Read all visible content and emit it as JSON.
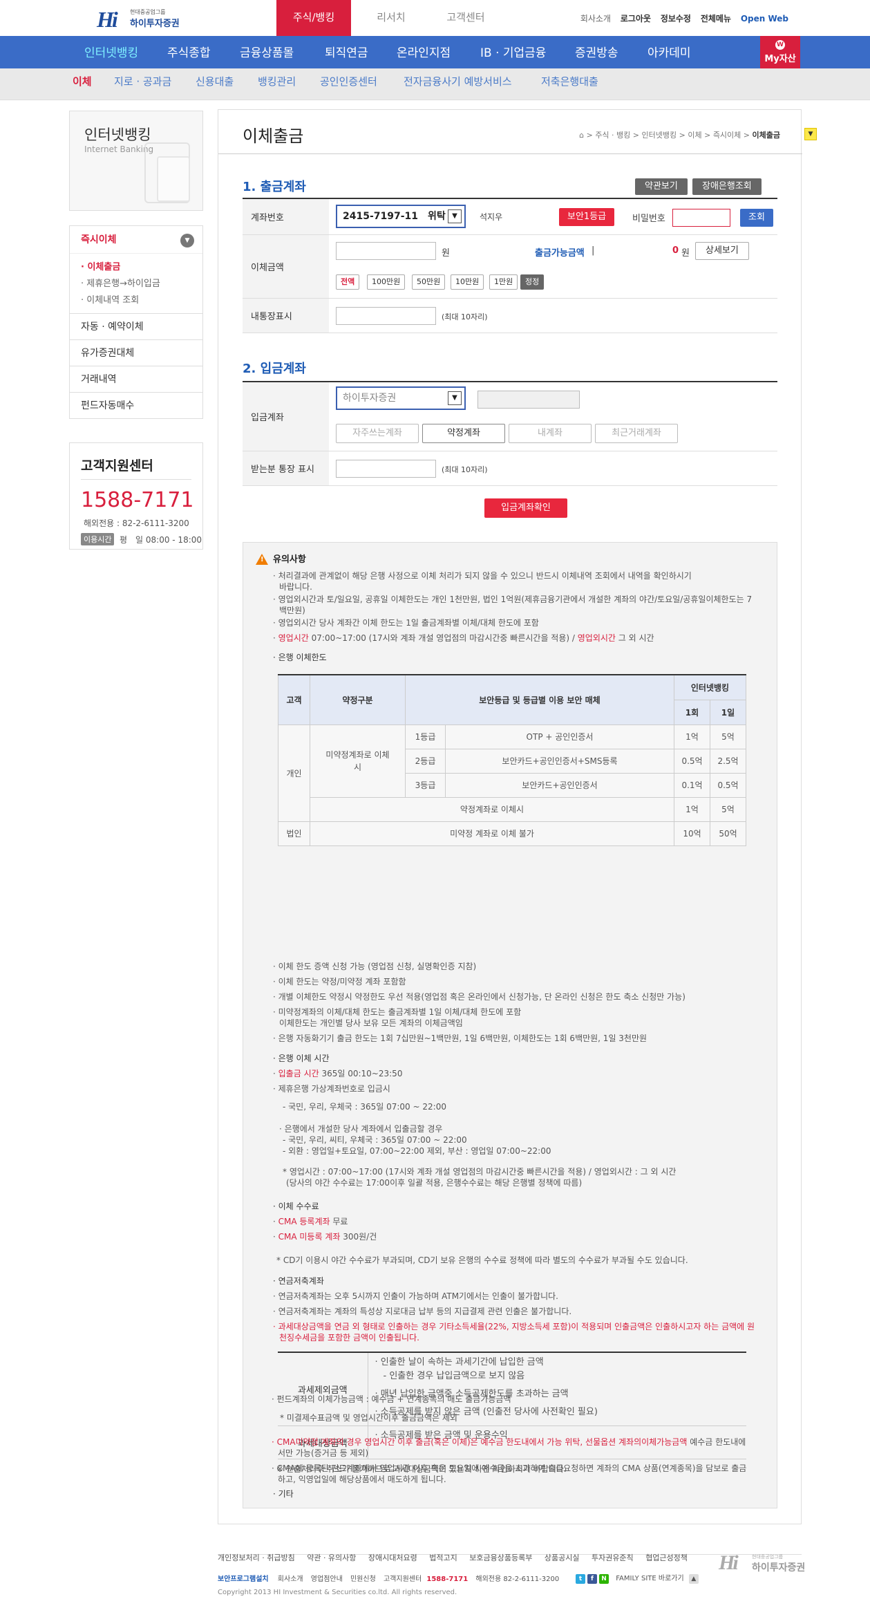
{
  "header": {
    "logo_sub": "현대중공업그룹",
    "logo_name": "하이투자증권",
    "tabs": [
      "주식/뱅킹",
      "리서치",
      "고객센터"
    ],
    "util": [
      "회사소개",
      "로그아웃",
      "정보수정",
      "전체메뉴",
      "Open Web"
    ]
  },
  "gnb": [
    "인터넷뱅킹",
    "주식종합",
    "금융상품몰",
    "퇴직연금",
    "온라인지점",
    "IB · 기업금융",
    "증권방송",
    "아카데미"
  ],
  "myasset": "My자산",
  "lnb": [
    "이체",
    "지로 · 공과금",
    "신용대출",
    "뱅킹관리",
    "공인인증센터",
    "전자금융사기 예방서비스",
    "저축은행대출"
  ],
  "left": {
    "title": "인터넷뱅킹",
    "title_en": "Internet Banking",
    "menu_head": "즉시이체",
    "sub": [
      "이체출금",
      "제휴은행→하이입금",
      "이체내역 조회"
    ],
    "rows": [
      "자동 · 예약이체",
      "유가증권대체",
      "거래내역",
      "펀드자동매수"
    ],
    "cs_title": "고객지원센터",
    "cs_phone": "1588-7171",
    "cs_overseas": "해외전용 : 82-2-6111-3200",
    "cs_hours_label": "이용시간",
    "cs_hours": "평　일 08:00 - 18:00"
  },
  "main": {
    "title": "이체출금",
    "breadcrumb": [
      "주식 · 뱅킹",
      "인터넷뱅킹",
      "이체",
      "즉시이체",
      "이체출금"
    ],
    "sec1": "1. 출금계좌",
    "btn_terms": "약관보기",
    "btn_failure": "장애은행조회",
    "lbl_account": "계좌번호",
    "account_value": "2415-7197-11　위탁",
    "account_name": "석지우",
    "security_badge": "보안1등급",
    "lbl_password": "비밀번호",
    "btn_inquiry": "조회",
    "lbl_amount": "이체금액",
    "won": "원",
    "avail_label": "출금가능금액",
    "avail_value": "0",
    "btn_detail": "상세보기",
    "amount_btns": [
      "전액",
      "100만원",
      "50만원",
      "10만원",
      "1만원",
      "정정"
    ],
    "lbl_memo": "내통장표시",
    "max10": "(최대 10자리)",
    "sec2": "2. 입금계좌",
    "lbl_in_account": "입금계좌",
    "bank_select": "하이투자증권",
    "acct_tabs": [
      "자주쓰는계좌",
      "약정계좌",
      "내계좌",
      "최근거래계좌"
    ],
    "lbl_recv": "받는분 통장 표시",
    "btn_confirm": "입금계좌확인"
  },
  "notice": {
    "title": "유의사항",
    "n1a": "· 처리결과에 관계없이 해당 은행 사정으로 이체 처리가 되지 않을 수 있으니 반드시 이체내역 조회에서 내역을 확인하시기",
    "n1b": "바랍니다.",
    "n2a": "· 영업외시간과 토/일요일, 공휴일 이체한도는 개인 1천만원, 법인 1억원(제휴금융기관에서 개설한 계좌의 야간/토요일/공휴일이체한도는 7",
    "n2b": "백만원)",
    "n3": "· 영업외시간 당사 계좌간 이체 한도는 1일 출금계좌별 이체/대체 한도에 포함",
    "n4_pre": "· ",
    "n4_r1": "영업시간",
    "n4_mid": " 07:00~17:00 (17시와 계좌 개설 영업점의 마감시간중 빠른시간을 적용) / ",
    "n4_r2": "영업외시간",
    "n4_post": " 그 외 시간",
    "limit_head": "· 은행 이체한도",
    "tbl": {
      "h_customer": "고객",
      "h_contract": "약정구분",
      "h_media": "보안등급 및 등급별 이용 보안 매체",
      "h_inet": "인터넷뱅킹",
      "h_once": "1회",
      "h_day": "1일",
      "personal": "개인",
      "noncontract": "미약정계좌로 이체시",
      "grades": [
        "1등급",
        "2등급",
        "3등급"
      ],
      "medias": [
        "OTP + 공인인증서",
        "보안카드+공인인증서+SMS등록",
        "보안카드+공인인증서"
      ],
      "once": [
        "1억",
        "0.5억",
        "0.1억",
        "1억",
        "10억"
      ],
      "day": [
        "5억",
        "2.5억",
        "0.5억",
        "5억",
        "50억"
      ],
      "contract": "약정계좌로 이체시",
      "corp": "법인",
      "corp_desc": "미약정 계좌로 이체 불가"
    },
    "l1": "· 이체 한도 증액 신청 가능 (영업점 신청, 실명확인증 지참)",
    "l2": "· 이체 한도는 약정/미약정 계좌 포함함",
    "l3": "· 개별 이체한도 약정시 약정한도 우선 적용(영업점 혹은 온라인에서 신청가능, 단 온라인 신청은 한도 축소 신청만 가능)",
    "l4a": "· 미약정계좌의 이체/대체 한도는 출금계좌별 1일 이체/대체 한도에 포함",
    "l4b": "이체한도는 개인별 당사 보유 모든 계좌의 이체금액임",
    "l5": "· 은행 자동화기기 출금 한도는 1회 7십만원~1백만원, 1일 6백만원, 이체한도는 1회 6백만원, 1일 3천만원",
    "time_head": "· 은행 이체 시간",
    "t1_r": "입출금 시간",
    "t1_post": " 365일 00:10~23:50",
    "t2": "· 제휴은행 가상계좌번호로 입금시",
    "t3": "- 국민, 우리, 우체국 : 365일 07:00 ~ 22:00",
    "t4": "· 은행에서 개설한 당사 계좌에서 입출금할 경우",
    "t5": "- 국민, 우리, 씨티, 우체국 : 365일 07:00 ~ 22:00",
    "t6": "- 외환 : 영업일+토요일, 07:00~22:00 제외, 부산 : 영업일 07:00~22:00",
    "t7": "* 영업시간 : 07:00~17:00 (17시와 계좌 개설 영업점의 마감시간중 빠른시간을 적용) / 영업외시간 : 그 외 시간",
    "t8": "(당사의 야간 수수료는 17:00이후 일괄 적용, 은행수수료는 해당 은행별 정책에 따름)",
    "fee_head": "· 이체 수수료",
    "f1_r": "CMA 등록계좌",
    "f1_post": "  무료",
    "f2_r": "CMA 미등록 계좌",
    "f2_post": "  300원/건",
    "f3": "* CD기 이용시 야간 수수료가 부과되며, CD기 보유 은행의 수수료 정책에 따라 별도의 수수료가 부과될 수도 있습니다.",
    "pen_head": "· 연금저축계좌",
    "p1": "· 연금저축계좌는 오후 5시까지 인출이 가능하며 ATM기에서는 인출이 불가합니다.",
    "p2": "· 연금저축계좌는 계좌의 특성상 지로대금 납부 등의 지급결제 관련 인출은 불가합니다.",
    "p3a": "· 과세대상금액을 연금 외 형태로 인출하는 경우 기타소득세율(22%, 지방소득세 포함)이 적용되며 인출금액은 인출하시고자 하는 금액에 원",
    "p3b": "천징수세금을 포함한 금액이 인출됩니다.",
    "tax_excl": "과세제외금액",
    "tax_incl": "과세대상금액",
    "tx1": "· 인출한 날이 속하는 과세기간에 납입한 금액",
    "tx2": "- 인출한 경우 납입금액으로 보지 않음",
    "tx3": "· 매년 납입한 금액중 소득공제한도를 초과하는 금액",
    "tx4": "· 소득공제를 받지 않은 금액 (인출전 당사에 사전확인 필요)",
    "tx5": "· 소득공제를 받은 금액 및 운용수익",
    "tx_note": "※ 인출처리후 취소가 불가하므로 과세대상금액이 있는지 사전 확인하시기 바랍니다.",
    "etc_head": "· 기타",
    "e1": "· 펀드계좌의 이체가능금액 : 예수금 + 연계종목의 매도 출금가능금액",
    "e2": "* 미결제수표금액 및 영업시간이후 출금금액은 제외",
    "e3a_r": "· CMA미약정 계좌의 경우 영업시간 이후 출금(혹은 이체)은 예수금 한도내에서 가능 위탁, 선물옵션 계좌의이체가능금액",
    "e3a_post": " 예수금 한도내에",
    "e3b": "서만 가능(증거금 등 제외)",
    "e4a": "· CMA에 등록된 펀드계좌에서 영업시간 이후 혹은 토요일에 예수금을 초과하여 출금요청하면 계좌의 CMA 상품(연계종목)을 담보로 출금",
    "e4b": "하고, 익영업일에 해당상품에서 매도하게 됩니다."
  },
  "footer": {
    "links": [
      "개인정보처리 · 취급방침",
      "약관 · 유의사항",
      "장애시대처요령",
      "법적고지",
      "보호금융상품등록부",
      "상품공시실",
      "투자권유준칙",
      "협업근성정책"
    ],
    "row2_b": "보안프로그램설치",
    "row2": [
      "회사소개",
      "영업점안내",
      "민원신청",
      "고객지원센터"
    ],
    "phone": "1588-7171",
    "overseas": "해외전용 82-2-6111-3200",
    "family": "FAMILY SITE 바로가기",
    "copyright": "Copyright 2013 HI Investment & Securities co.ltd. All rights reserved."
  },
  "colors": {
    "red": "#d81f3d",
    "blue": "#3a6cc7",
    "title_blue": "#1f5cb5"
  }
}
